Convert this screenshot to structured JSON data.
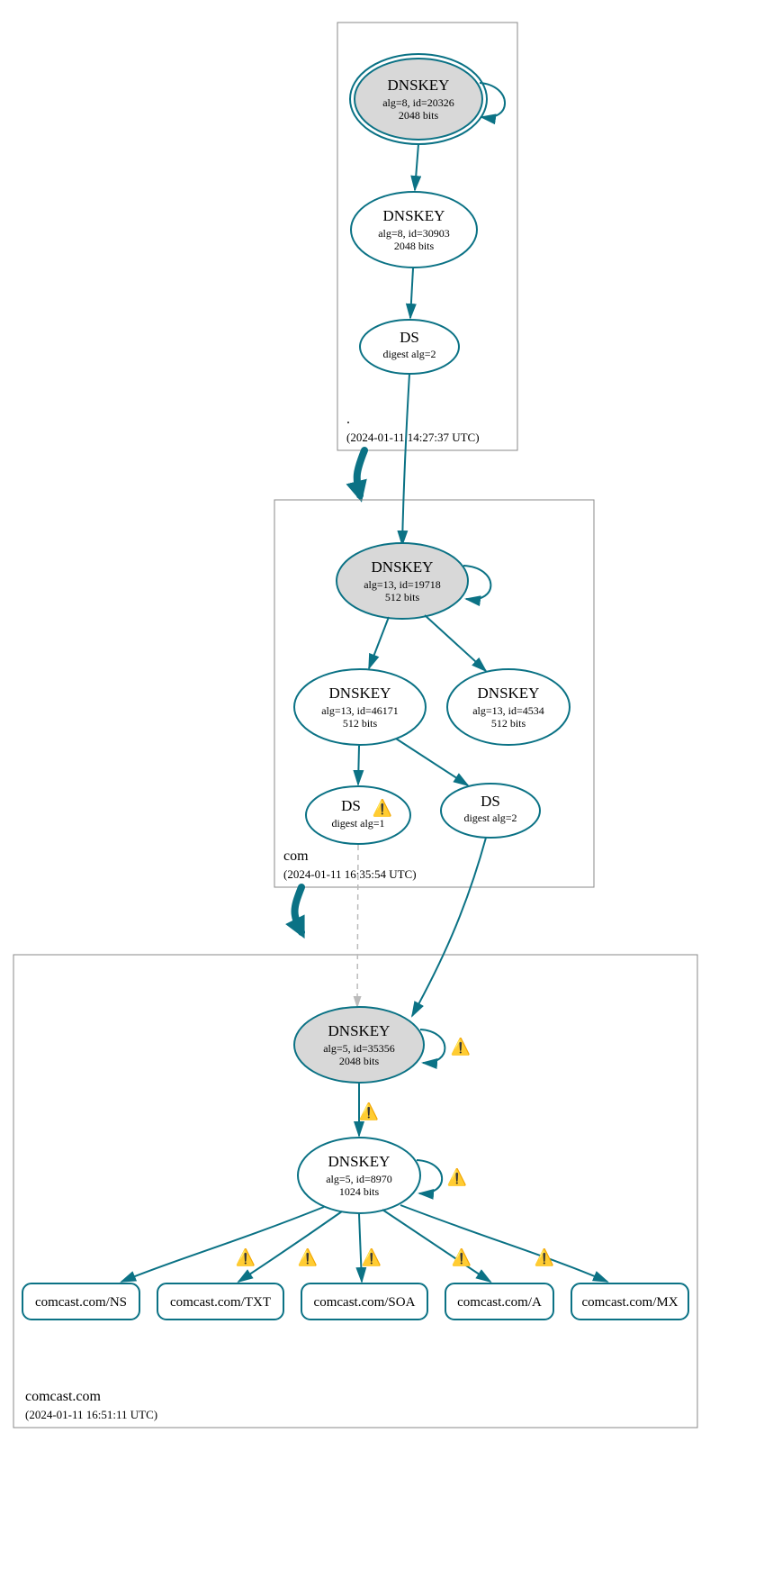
{
  "zones": {
    "root": {
      "name": ".",
      "timestamp": "(2024-01-11 14:27:37 UTC)"
    },
    "com": {
      "name": "com",
      "timestamp": "(2024-01-11 16:35:54 UTC)"
    },
    "target": {
      "name": "comcast.com",
      "timestamp": "(2024-01-11 16:51:11 UTC)"
    }
  },
  "nodes": {
    "root_ksk": {
      "title": "DNSKEY",
      "l1": "alg=8, id=20326",
      "l2": "2048 bits"
    },
    "root_zsk": {
      "title": "DNSKEY",
      "l1": "alg=8, id=30903",
      "l2": "2048 bits"
    },
    "root_ds": {
      "title": "DS",
      "l1": "digest alg=2"
    },
    "com_ksk": {
      "title": "DNSKEY",
      "l1": "alg=13, id=19718",
      "l2": "512 bits"
    },
    "com_zsk1": {
      "title": "DNSKEY",
      "l1": "alg=13, id=46171",
      "l2": "512 bits"
    },
    "com_zsk2": {
      "title": "DNSKEY",
      "l1": "alg=13, id=4534",
      "l2": "512 bits"
    },
    "com_ds1": {
      "title": "DS",
      "l1": "digest alg=1"
    },
    "com_ds2": {
      "title": "DS",
      "l1": "digest alg=2"
    },
    "tgt_ksk": {
      "title": "DNSKEY",
      "l1": "alg=5, id=35356",
      "l2": "2048 bits"
    },
    "tgt_zsk": {
      "title": "DNSKEY",
      "l1": "alg=5, id=8970",
      "l2": "1024 bits"
    }
  },
  "rrsets": {
    "ns": "comcast.com/NS",
    "txt": "comcast.com/TXT",
    "soa": "comcast.com/SOA",
    "a": "comcast.com/A",
    "mx": "comcast.com/MX"
  },
  "icons": {
    "warn": "⚠️"
  }
}
